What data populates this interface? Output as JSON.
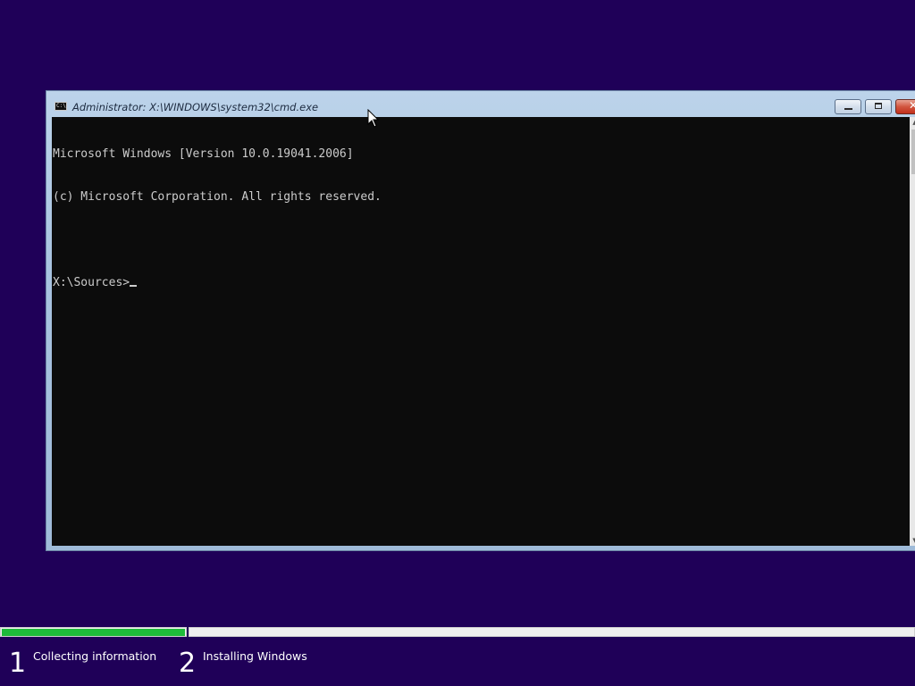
{
  "window": {
    "title": "Administrator: X:\\WINDOWS\\system32\\cmd.exe",
    "icon_name": "cmd-icon",
    "icon_text": "C:\\"
  },
  "console": {
    "lines": [
      "Microsoft Windows [Version 10.0.19041.2006]",
      "(c) Microsoft Corporation. All rights reserved.",
      "",
      "X:\\Sources>"
    ]
  },
  "setup": {
    "steps": [
      {
        "number": "1",
        "label": "Collecting information"
      },
      {
        "number": "2",
        "label": "Installing Windows"
      }
    ],
    "step1_progress": 1.0,
    "progress_color": "#1ebb3a"
  },
  "colors": {
    "background": "#1f0058",
    "console_bg": "#0c0c0c",
    "console_fg": "#cccccc"
  }
}
